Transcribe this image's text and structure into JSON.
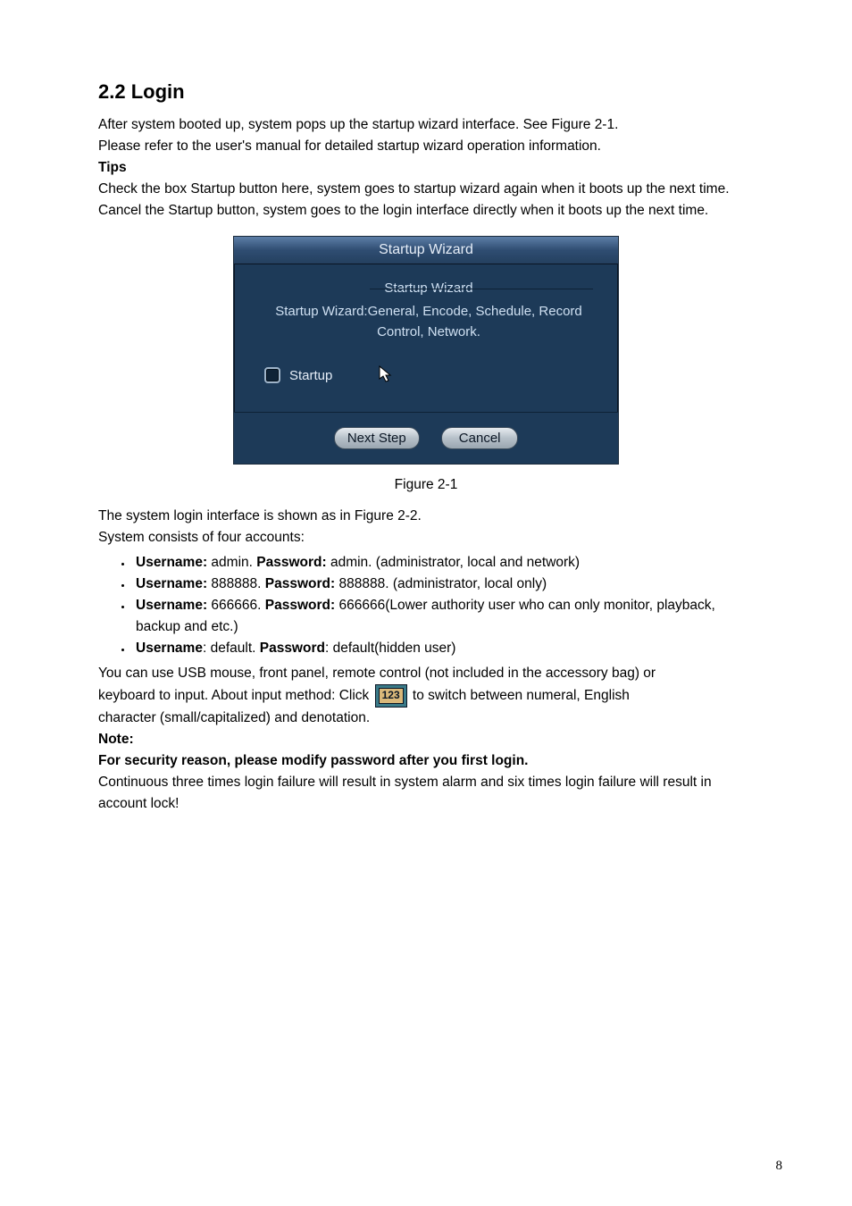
{
  "heading": "2.2  Login",
  "para1a": "After system booted up, system pops up the startup wizard interface. See Figure 2-1.",
  "para1b": "Please refer to the user's manual for detailed startup wizard operation information.",
  "tips_label": "Tips",
  "para2": "Check the box Startup button here, system goes to startup wizard again when it boots up the next time.",
  "para3": "Cancel the Startup button, system goes to the login interface directly when it boots up the next time.",
  "dialog": {
    "title": "Startup Wizard",
    "group_label": "Startup Wizard",
    "desc": "Startup Wizard:General, Encode, Schedule, Record Control, Network.",
    "startup_label": "Startup",
    "next_btn": "Next Step",
    "cancel_btn": "Cancel"
  },
  "figure_caption": "Figure 2-1",
  "para4a": "The system login interface is shown as in Figure 2-2.",
  "para4b": "System consists of four accounts:",
  "accounts": [
    {
      "u_label": "Username:",
      "u": " admin.  ",
      "p_label": "Password:",
      "p": " admin. (administrator, local and network)"
    },
    {
      "u_label": "Username:",
      "u": " 888888. ",
      "p_label": "Password:",
      "p": " 888888. (administrator, local only)"
    },
    {
      "u_label": "Username:",
      "u": " 666666. ",
      "p_label": "Password:",
      "p": " 666666(Lower authority user who can only monitor, playback, backup and etc.)"
    },
    {
      "u_label": "Username",
      "u": ": default. ",
      "p_label": "Password",
      "p": ": default(hidden user)"
    }
  ],
  "para5a": "You can use USB mouse, front panel, remote control (not included in the accessory bag) or",
  "para5b_pre": "keyboard to input. About input method: Click ",
  "ime_text": "123",
  "para5b_post": " to switch between numeral, English",
  "para5c": "character (small/capitalized) and denotation.",
  "note_label": "Note:",
  "note_bold": "For security reason, please modify password after you first login.",
  "para6": "Continuous three times login failure will result in system alarm and six times login failure will result in account lock!",
  "page_number": "8"
}
